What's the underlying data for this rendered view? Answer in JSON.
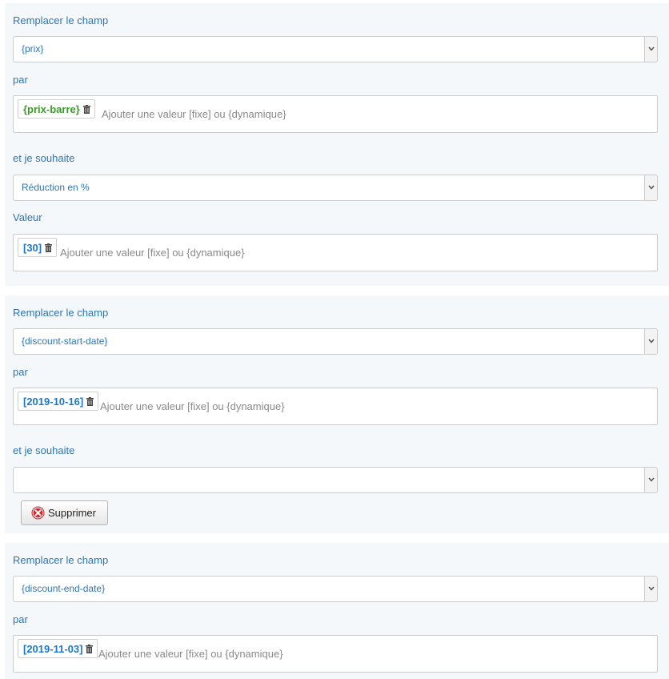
{
  "rule1": {
    "field_label": "Remplacer le champ",
    "field_value": "{prix}",
    "by_label": "par",
    "by_tag": "{prix-barre}",
    "placeholder": "Ajouter une valeur [fixe] ou {dynamique}",
    "wish_label": "et je souhaite",
    "wish_value": "Réduction en %",
    "value_label": "Valeur",
    "value_tag": "[30]"
  },
  "rule2": {
    "field_label": "Remplacer le champ",
    "field_value": "{discount-start-date}",
    "by_label": "par",
    "by_tag": "[2019-10-16]",
    "placeholder": "Ajouter une valeur [fixe] ou {dynamique}",
    "wish_label": "et je souhaite",
    "wish_value": "",
    "delete_label": "Supprimer"
  },
  "rule3": {
    "field_label": "Remplacer le champ",
    "field_value": "{discount-end-date}",
    "by_label": "par",
    "by_tag": "[2019-11-03]",
    "placeholder": "Ajouter une valeur [fixe] ou {dynamique}"
  },
  "icons": {
    "dropdown": "chevron-down-icon",
    "remove_tag": "trash-icon",
    "delete": "red-x-circle-icon"
  },
  "colors": {
    "label_blue": "#2e75b6",
    "tag_blue": "#1e78c8",
    "tag_green": "#3a9a2a",
    "placeholder_gray": "#8a8a8a",
    "panel_bg": "#f4f8fa",
    "delete_red": "#d9262b"
  }
}
